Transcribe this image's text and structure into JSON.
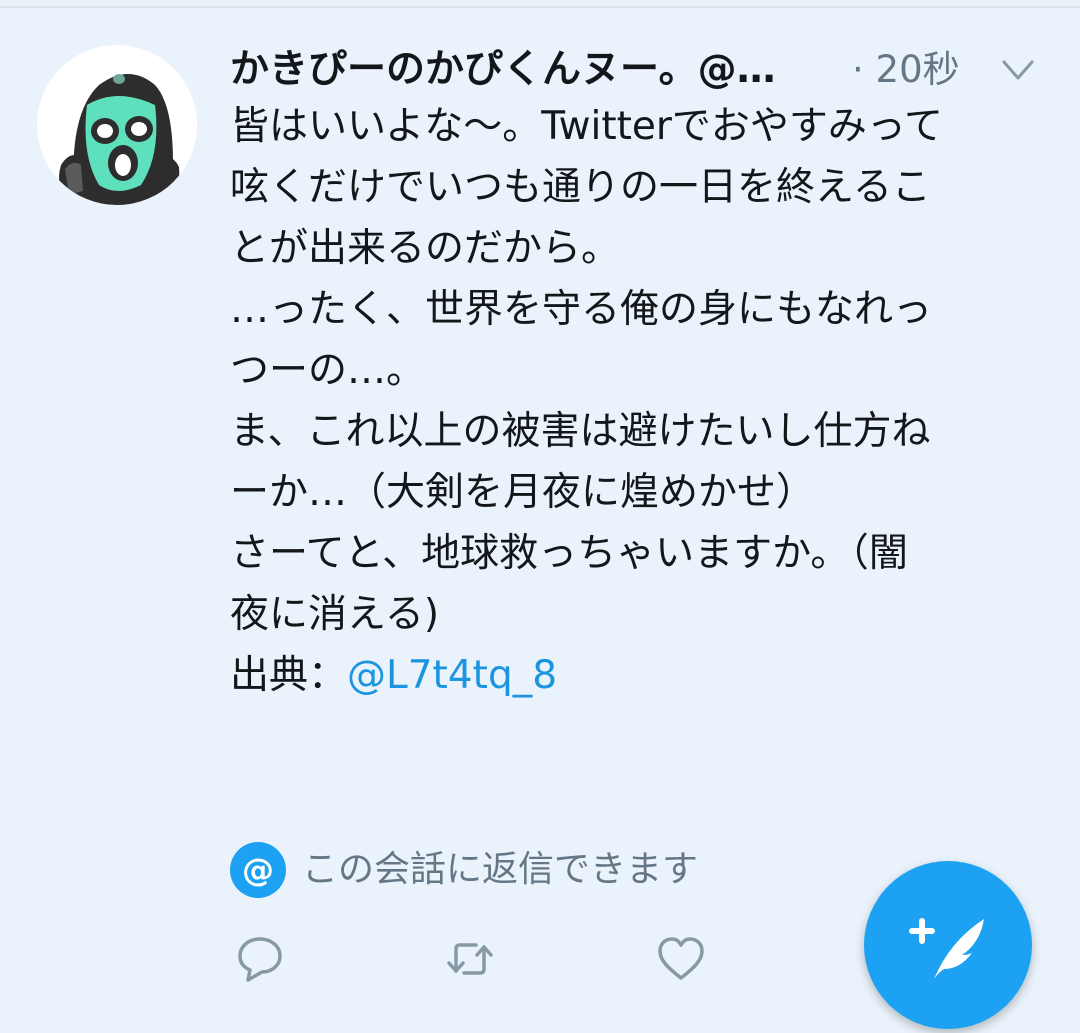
{
  "tweet": {
    "display_name": "かきぴーのかぴくんヌー。@…",
    "timestamp": "· 20秒",
    "text_lines": [
      "皆はいいよな〜。Twitterでおやすみって",
      "呟くだけでいつも通りの一日を終えるこ",
      "とが出来るのだから。",
      "…ったく、世界を守る俺の身にもなれっ",
      "つーの…。",
      "ま、これ以上の被害は避けたいし仕方ね",
      "ーか…（大剣を月夜に煌めかせ）",
      "",
      "さーてと、地球救っちゃいますか。（闇",
      "夜に消える)",
      "",
      "出典："
    ],
    "source_mention": "@L7t4tq_8"
  },
  "reply_banner": {
    "badge": "@",
    "text": "この会話に返信できます"
  },
  "colors": {
    "background": "#eaf3fb",
    "accent": "#1da1f2",
    "link": "#1b95e0",
    "secondary_text": "#657786",
    "icon_gray": "#8899a6"
  },
  "icons": {
    "caret": "chevron-down-icon",
    "reply": "reply-icon",
    "retweet": "retweet-icon",
    "like": "heart-icon",
    "compose": "compose-tweet-icon"
  }
}
